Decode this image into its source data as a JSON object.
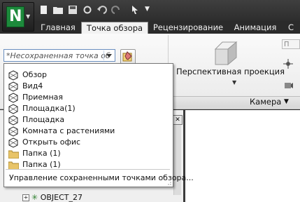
{
  "tabs": [
    {
      "label": "Главная",
      "active": false
    },
    {
      "label": "Точка обзора",
      "active": true
    },
    {
      "label": "Рецензирование",
      "active": false
    },
    {
      "label": "Анимация",
      "active": false
    },
    {
      "label": "С",
      "active": false
    }
  ],
  "viewpoint_combo": {
    "value": "*Несохраненная точка об"
  },
  "ribbon": {
    "perspective_label": "Перспективная проекция",
    "camera_panel_label": "Камера",
    "right_field": "П"
  },
  "dropdown": {
    "items": [
      {
        "label": "Обзор",
        "icon": "viewpoint-icon"
      },
      {
        "label": "Вид4",
        "icon": "viewpoint-icon"
      },
      {
        "label": "Приемная",
        "icon": "viewpoint-icon"
      },
      {
        "label": "Площадка(1)",
        "icon": "viewpoint-icon"
      },
      {
        "label": "Площадка",
        "icon": "viewpoint-icon"
      },
      {
        "label": "Комната с растениями",
        "icon": "viewpoint-icon"
      },
      {
        "label": "Открыть офис",
        "icon": "viewpoint-icon"
      },
      {
        "label": "Папка (1)",
        "icon": "folder-icon"
      },
      {
        "label": "Папка (1)",
        "icon": "folder-icon"
      }
    ],
    "manage_label": "Управление сохраненными точками обзора..."
  },
  "tree": {
    "row_label": "OBJECT_27"
  },
  "colors": {
    "accent_green": "#1d8a3c",
    "dark_bg": "#2b2b2b"
  }
}
